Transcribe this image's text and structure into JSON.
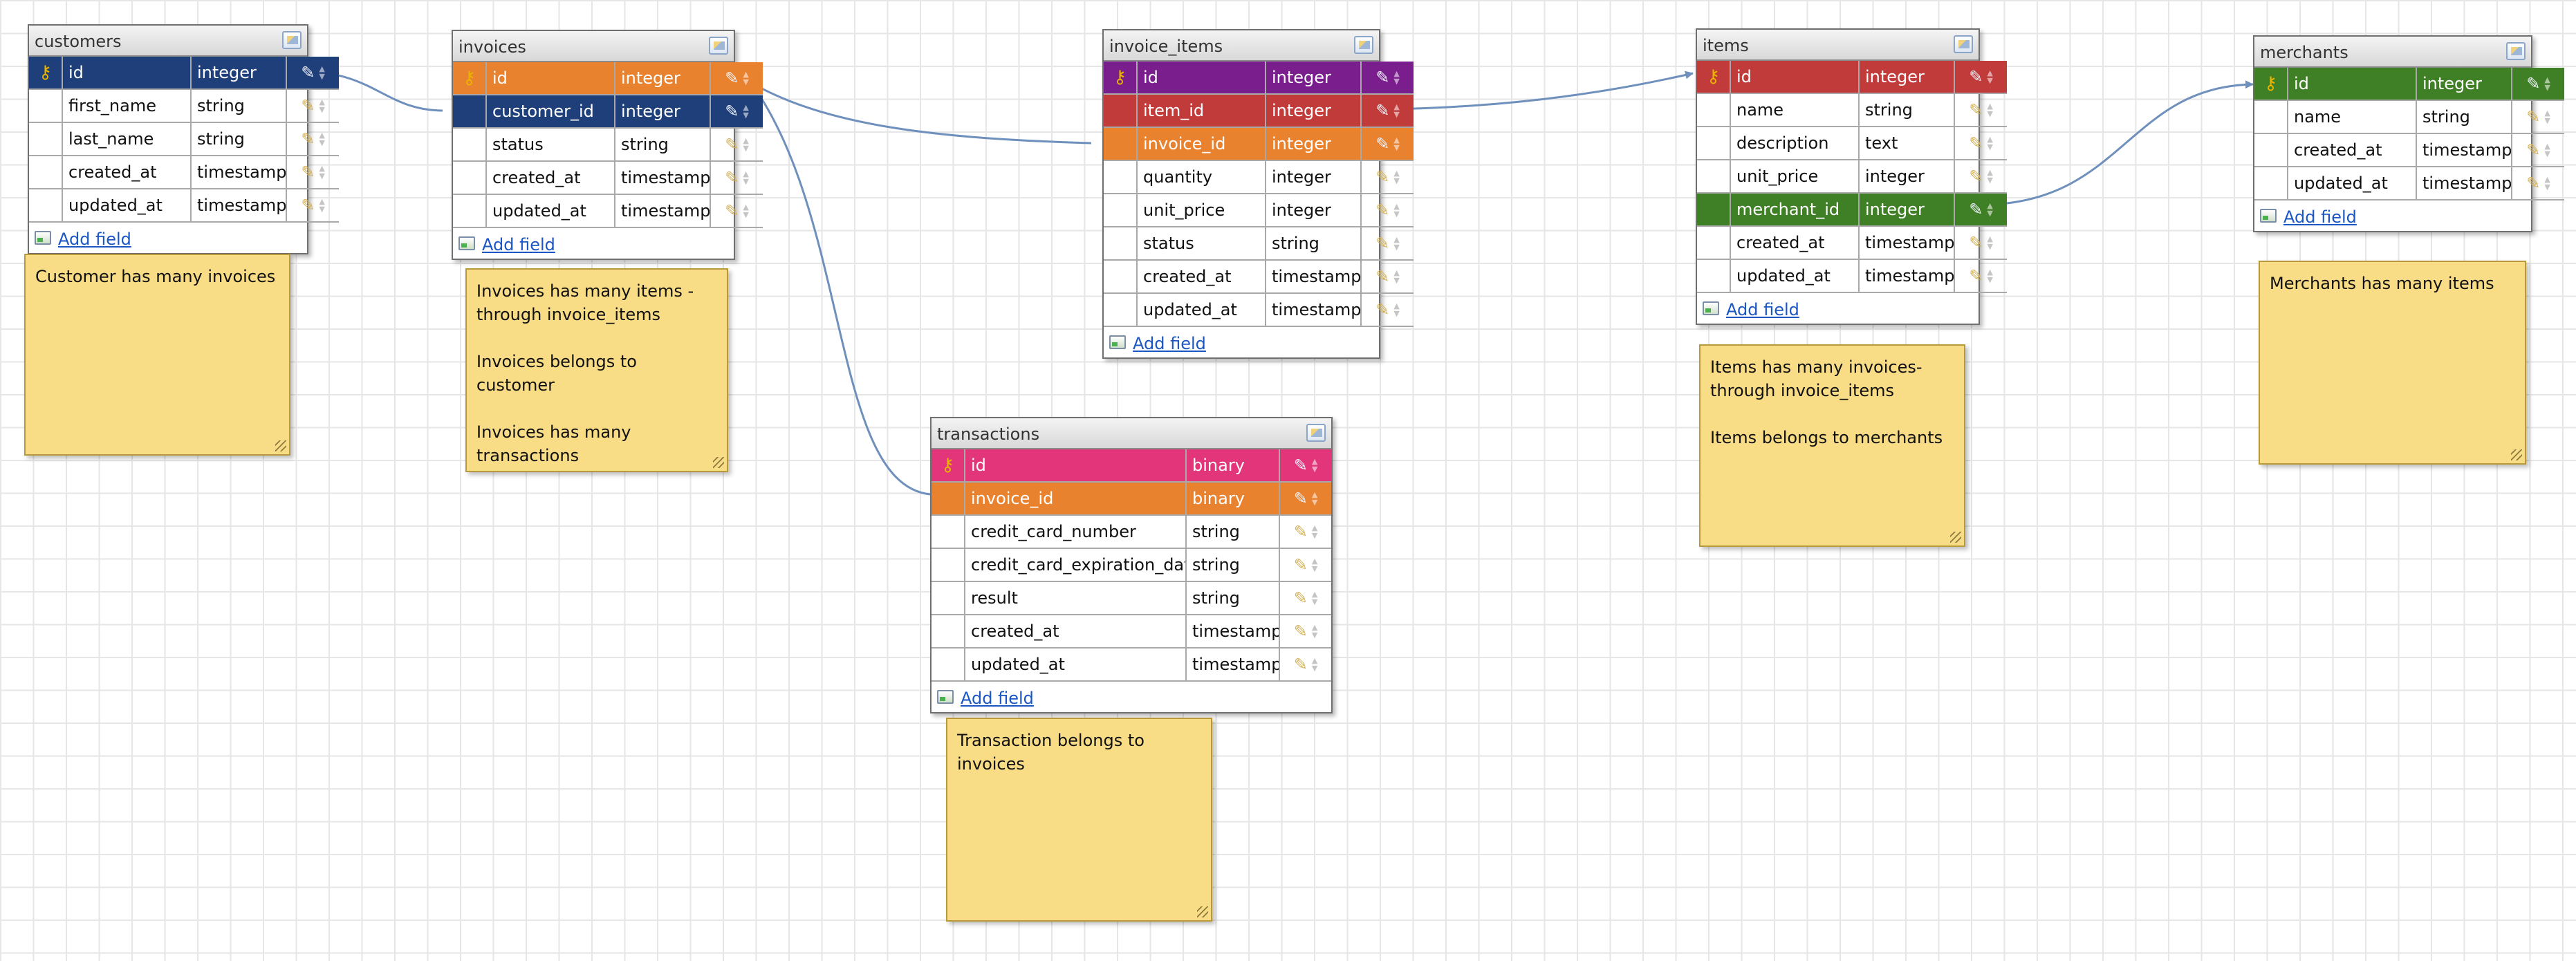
{
  "colors": {
    "navy": "#1f3f7a",
    "orange": "#e9822f",
    "purple": "#7a1e8e",
    "red": "#c23b3b",
    "green": "#3f7f25",
    "pink": "#e3357a",
    "note": "#f8dc86",
    "connector": "#6f90bd"
  },
  "ui": {
    "add_field": "Add field",
    "icons": {
      "key": "key-icon",
      "edit": "pencil-icon",
      "order": "up-down-arrows-icon",
      "add": "add-field-icon",
      "table_edit": "edit-table-icon",
      "resize": "resize-grip-icon"
    }
  },
  "tables": [
    {
      "id": "customers",
      "name": "customers",
      "rows": [
        {
          "name": "id",
          "type": "integer",
          "pk": true,
          "hl": "navy"
        },
        {
          "name": "first_name",
          "type": "string"
        },
        {
          "name": "last_name",
          "type": "string"
        },
        {
          "name": "created_at",
          "type": "timestamp"
        },
        {
          "name": "updated_at",
          "type": "timestamp"
        }
      ]
    },
    {
      "id": "invoices",
      "name": "invoices",
      "rows": [
        {
          "name": "id",
          "type": "integer",
          "pk": true,
          "hl": "orange"
        },
        {
          "name": "customer_id",
          "type": "integer",
          "hl": "navy"
        },
        {
          "name": "status",
          "type": "string"
        },
        {
          "name": "created_at",
          "type": "timestamp"
        },
        {
          "name": "updated_at",
          "type": "timestamp"
        }
      ]
    },
    {
      "id": "invoice_items",
      "name": "invoice_items",
      "rows": [
        {
          "name": "id",
          "type": "integer",
          "pk": true,
          "hl": "purple"
        },
        {
          "name": "item_id",
          "type": "integer",
          "hl": "red"
        },
        {
          "name": "invoice_id",
          "type": "integer",
          "hl": "orange"
        },
        {
          "name": "quantity",
          "type": "integer"
        },
        {
          "name": "unit_price",
          "type": "integer"
        },
        {
          "name": "status",
          "type": "string"
        },
        {
          "name": "created_at",
          "type": "timestamp"
        },
        {
          "name": "updated_at",
          "type": "timestamp"
        }
      ]
    },
    {
      "id": "items",
      "name": "items",
      "rows": [
        {
          "name": "id",
          "type": "integer",
          "pk": true,
          "hl": "red"
        },
        {
          "name": "name",
          "type": "string"
        },
        {
          "name": "description",
          "type": "text"
        },
        {
          "name": "unit_price",
          "type": "integer"
        },
        {
          "name": "merchant_id",
          "type": "integer",
          "hl": "green"
        },
        {
          "name": "created_at",
          "type": "timestamp"
        },
        {
          "name": "updated_at",
          "type": "timestamp"
        }
      ]
    },
    {
      "id": "merchants",
      "name": "merchants",
      "rows": [
        {
          "name": "id",
          "type": "integer",
          "pk": true,
          "hl": "green"
        },
        {
          "name": "name",
          "type": "string"
        },
        {
          "name": "created_at",
          "type": "timestamp"
        },
        {
          "name": "updated_at",
          "type": "timestamp"
        }
      ]
    },
    {
      "id": "transactions",
      "name": "transactions",
      "rows": [
        {
          "name": "id",
          "type": "binary",
          "pk": true,
          "hl": "pink"
        },
        {
          "name": "invoice_id",
          "type": "binary",
          "hl": "orange"
        },
        {
          "name": "credit_card_number",
          "type": "string"
        },
        {
          "name": "credit_card_expiration_date",
          "type": "string"
        },
        {
          "name": "result",
          "type": "string"
        },
        {
          "name": "created_at",
          "type": "timestamp"
        },
        {
          "name": "updated_at",
          "type": "timestamp"
        }
      ]
    }
  ],
  "notes": [
    {
      "id": "customers-note",
      "lines": [
        "Customer has many invoices"
      ]
    },
    {
      "id": "invoices-note",
      "lines": [
        "Invoices has many items -",
        "through invoice_items",
        "",
        "Invoices belongs to customer",
        "",
        "Invoices has many transactions"
      ]
    },
    {
      "id": "items-note",
      "lines": [
        "Items has many invoices-",
        "through invoice_items",
        "",
        "Items belongs to merchants"
      ]
    },
    {
      "id": "merchants-note",
      "lines": [
        "Merchants has many items"
      ]
    },
    {
      "id": "transactions-note",
      "lines": [
        "Transaction belongs to invoices"
      ]
    }
  ]
}
